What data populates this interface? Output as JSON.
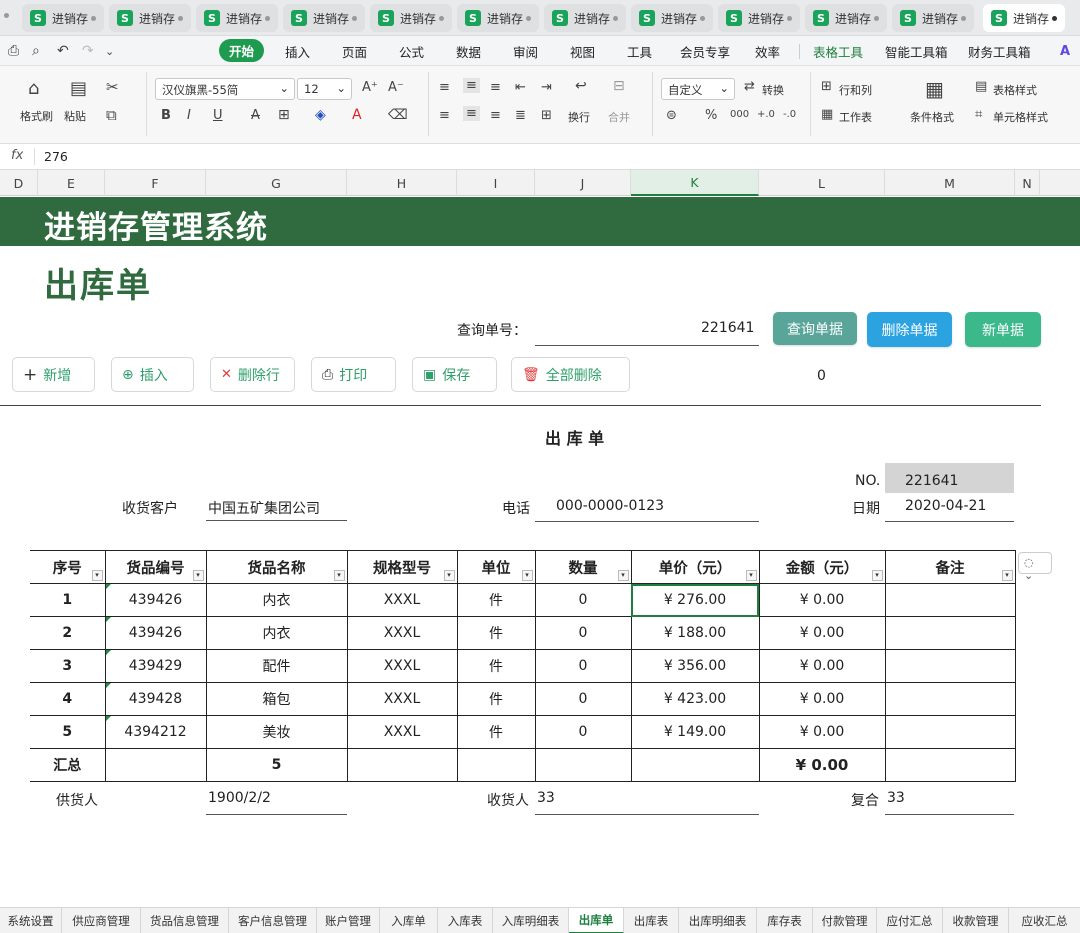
{
  "doc_tabs": [
    "进销存",
    "进销存",
    "进销存",
    "进销存",
    "进销存",
    "进销存",
    "进销存",
    "进销存",
    "进销存",
    "进销存",
    "进销存",
    "进销存"
  ],
  "doc_tab_icon": "S",
  "menu": {
    "items": [
      "开始",
      "插入",
      "页面",
      "公式",
      "数据",
      "审阅",
      "视图",
      "工具",
      "会员专享",
      "效率",
      "表格工具",
      "智能工具箱",
      "财务工具箱"
    ],
    "active": "开始"
  },
  "ribbon": {
    "format_painter": "格式刷",
    "paste": "粘贴",
    "font_name": "汉仪旗黑-55简",
    "font_size": "12",
    "wrap": "换行",
    "merge": "合并",
    "number_format": "自定义",
    "convert": "转换",
    "row_col": "行和列",
    "worksheet": "工作表",
    "cond_format": "条件格式",
    "table_style": "表格样式",
    "cell_style": "单元格样式"
  },
  "formula": {
    "fx": "fx",
    "value": "276"
  },
  "columns": [
    "D",
    "E",
    "F",
    "G",
    "H",
    "I",
    "J",
    "K",
    "L",
    "M",
    "N"
  ],
  "selected_column": "K",
  "banner_title": "进销存管理系统",
  "subtitle": "出库单",
  "query": {
    "label": "查询单号：",
    "value": "221641",
    "btn_query": "查询单据",
    "btn_delete": "删除单据",
    "btn_new": "新单据"
  },
  "toolbar": {
    "add": "新增",
    "insert": "插入",
    "delete_row": "删除行",
    "print": "打印",
    "save": "保存",
    "delete_all": "全部删除",
    "count": "0"
  },
  "form": {
    "title": "出 库 单",
    "no_label": "NO.",
    "no_value": "221641",
    "customer_label": "收货客户",
    "customer_value": "中国五矿集团公司",
    "phone_label": "电话",
    "phone_value": "000-0000-0123",
    "date_label": "日期",
    "date_value": "2020-04-21"
  },
  "table": {
    "headers": [
      "序号",
      "货品编号",
      "货品名称",
      "规格型号",
      "单位",
      "数量",
      "单价（元）",
      "金额（元）",
      "备注"
    ],
    "rows": [
      [
        "1",
        "439426",
        "内衣",
        "XXXL",
        "件",
        "0",
        "¥ 276.00",
        "¥ 0.00",
        ""
      ],
      [
        "2",
        "439426",
        "内衣",
        "XXXL",
        "件",
        "0",
        "¥ 188.00",
        "¥ 0.00",
        ""
      ],
      [
        "3",
        "439429",
        "配件",
        "XXXL",
        "件",
        "0",
        "¥ 356.00",
        "¥ 0.00",
        ""
      ],
      [
        "4",
        "439428",
        "箱包",
        "XXXL",
        "件",
        "0",
        "¥ 423.00",
        "¥ 0.00",
        ""
      ],
      [
        "5",
        "4394212",
        "美妆",
        "XXXL",
        "件",
        "0",
        "¥ 149.00",
        "¥ 0.00",
        ""
      ]
    ],
    "summary": {
      "label": "汇总",
      "count": "5",
      "amount": "¥ 0.00"
    }
  },
  "footer": {
    "supplier_label": "供货人",
    "supplier_value": "1900/2/2",
    "receiver_label": "收货人",
    "receiver_value": "33",
    "reviewer_label": "复合",
    "reviewer_value": "33"
  },
  "sheet_tabs": [
    "系统设置",
    "供应商管理",
    "货品信息管理",
    "客户信息管理",
    "账户管理",
    "入库单",
    "入库表",
    "入库明细表",
    "出库单",
    "出库表",
    "出库明细表",
    "库存表",
    "付款管理",
    "应付汇总",
    "收款管理",
    "应收汇总"
  ],
  "active_sheet": "出库单",
  "colors": {
    "brand_green": "#2f6b3e",
    "query_btn": "#5aa59a",
    "delete_btn": "#2aa3e0",
    "new_btn": "#3bb98a"
  }
}
